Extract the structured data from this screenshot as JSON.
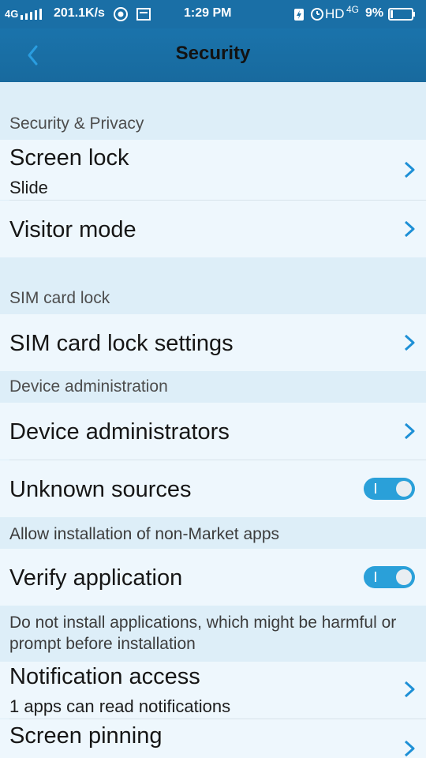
{
  "status_bar": {
    "network": "4G",
    "speed": "201.1K/s",
    "time": "1:29 PM",
    "hd": "HD",
    "net_type": "4G",
    "battery": "9%"
  },
  "header": {
    "title": "Security"
  },
  "sections": {
    "security_privacy": "Security & Privacy",
    "sim_card_lock": "SIM card lock",
    "device_administration": "Device administration"
  },
  "items": {
    "screen_lock": {
      "title": "Screen lock",
      "subtitle": "Slide"
    },
    "visitor_mode": {
      "title": "Visitor mode"
    },
    "sim_lock_settings": {
      "title": "SIM card lock settings"
    },
    "device_admins": {
      "title": "Device administrators"
    },
    "unknown_sources": {
      "title": "Unknown sources",
      "enabled": true,
      "description": "Allow installation of non-Market apps"
    },
    "verify_application": {
      "title": "Verify application",
      "enabled": true,
      "description": "Do not install applications, which might be harmful or prompt before installation"
    },
    "notification_access": {
      "title": "Notification access",
      "subtitle": "1 apps can read notifications"
    },
    "screen_pinning": {
      "title": "Screen pinning"
    }
  },
  "colors": {
    "accent": "#2aa0d9",
    "chevron": "#1e90d6",
    "app_bar": "#1a6fa6",
    "section_bg": "#ddeef8",
    "row_bg": "#eef7fd"
  },
  "icons": [
    "back-icon",
    "chevron-right-icon",
    "toggle-switch",
    "chrome-icon",
    "screenshot-icon",
    "charging-icon",
    "alarm-icon",
    "battery-icon",
    "signal-icon"
  ]
}
